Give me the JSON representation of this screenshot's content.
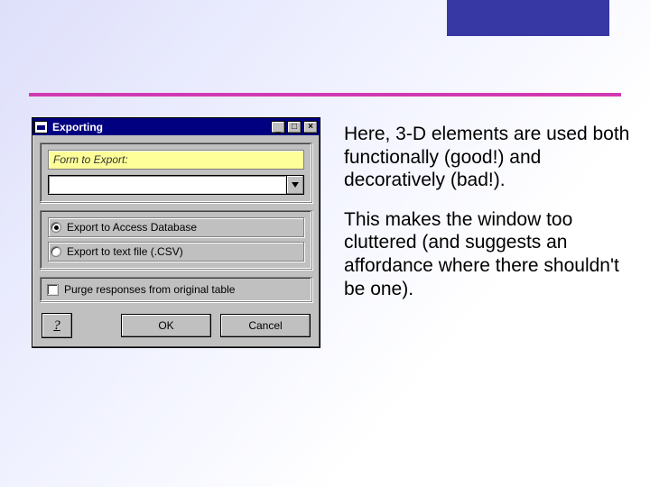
{
  "dialog": {
    "title": "Exporting",
    "form_label": "Form to Export:",
    "combo_value": "",
    "radio1": "Export to Access Database",
    "radio2": "Export to text file (.CSV)",
    "checkbox_label": "Purge responses from original table",
    "help_glyph": "?",
    "ok_label": "OK",
    "cancel_label": "Cancel",
    "winbtns": {
      "min": "_",
      "max": "□",
      "close": "×"
    }
  },
  "commentary": {
    "p1": "Here, 3-D elements are used both functionally (good!) and decoratively (bad!).",
    "p2": "This makes the window too cluttered (and suggests an affordance where there shouldn't be one)."
  }
}
